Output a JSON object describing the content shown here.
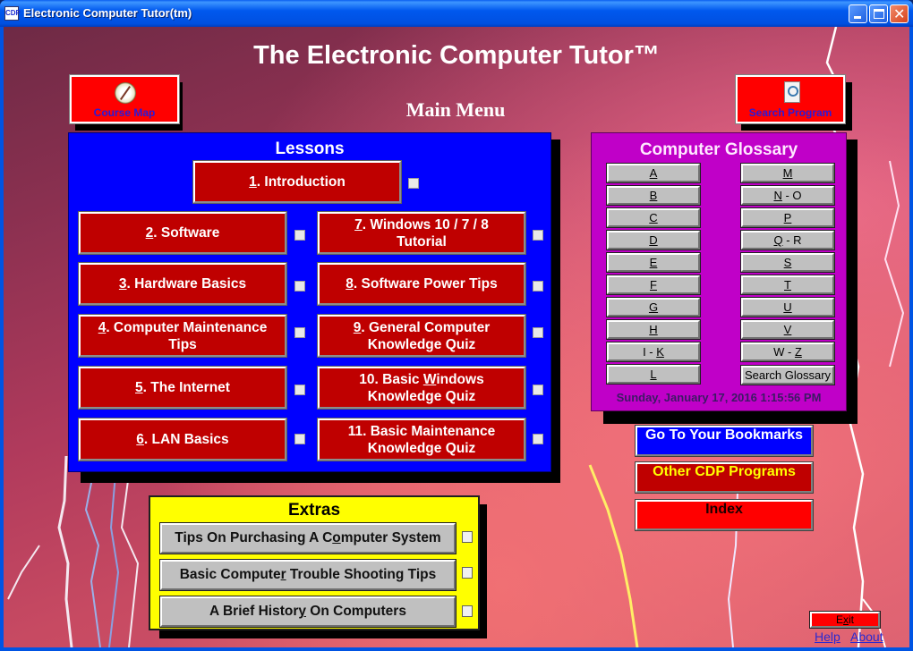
{
  "window": {
    "title": "Electronic Computer Tutor(tm)",
    "app_icon_text": "CDP",
    "controls": [
      "minimize",
      "maximize",
      "close"
    ]
  },
  "header": {
    "title": "The Electronic Computer Tutor™",
    "subtitle": "Main Menu"
  },
  "top_buttons": {
    "course_map": {
      "label": "Course Map",
      "icon": "compass-icon"
    },
    "search_program": {
      "label": "Search Program",
      "icon": "search-document-icon"
    }
  },
  "lessons": {
    "title": "Lessons",
    "items": [
      {
        "num": "1",
        "text": ". Introduction",
        "line2": ""
      },
      {
        "num": "2",
        "text": ". Software",
        "line2": ""
      },
      {
        "num": "3",
        "text": ". Hardware Basics",
        "line2": ""
      },
      {
        "num": "4",
        "text": ". Computer Maintenance",
        "line2": "Tips"
      },
      {
        "num": "5",
        "text": ". The Internet",
        "line2": ""
      },
      {
        "num": "6",
        "text": ". LAN Basics",
        "line2": ""
      },
      {
        "num": "7",
        "text": ". Windows 10 /  7 / 8",
        "line2": "Tutorial"
      },
      {
        "num": "8",
        "text": ". Software Power Tips",
        "line2": ""
      },
      {
        "num": "9",
        "text": ". General Computer",
        "line2": "Knowledge Quiz"
      },
      {
        "pre": "10. Basic ",
        "ul": "W",
        "post": "indows",
        "line2": "Knowledge Quiz"
      },
      {
        "pre": "11. Basic  Maintenance",
        "ul": "",
        "post": "",
        "line2": "Knowledge Quiz"
      }
    ]
  },
  "glossary": {
    "title": "Computer Glossary",
    "left": [
      {
        "ul": "A",
        "rest": ""
      },
      {
        "ul": "B",
        "rest": ""
      },
      {
        "ul": "C",
        "rest": ""
      },
      {
        "ul": "D",
        "rest": ""
      },
      {
        "ul": "E",
        "rest": ""
      },
      {
        "ul": "F",
        "rest": ""
      },
      {
        "ul": "G",
        "rest": ""
      },
      {
        "ul": "H",
        "rest": ""
      },
      {
        "pre": "I - ",
        "ul": "K",
        "rest": ""
      },
      {
        "ul": "L",
        "rest": ""
      }
    ],
    "right": [
      {
        "ul": "M",
        "rest": ""
      },
      {
        "ul": "N",
        "rest": " - O"
      },
      {
        "ul": "P",
        "rest": ""
      },
      {
        "ul": "Q",
        "rest": " - R"
      },
      {
        "ul": "S",
        "rest": ""
      },
      {
        "ul": "T",
        "rest": ""
      },
      {
        "ul": "U",
        "rest": ""
      },
      {
        "ul": "V",
        "rest": ""
      },
      {
        "pre": "W - ",
        "ul": "Z",
        "rest": ""
      }
    ],
    "search_label": "Search Glossary",
    "datetime": "Sunday, January 17, 2016 1:15:56 PM"
  },
  "side_buttons": {
    "bookmarks": "Go To Your Bookmarks",
    "other_programs": "Other CDP Programs",
    "index": "Index"
  },
  "extras": {
    "title": "Extras",
    "items": [
      {
        "pre": "Tips On Purchasing A C",
        "ul": "o",
        "post": "mputer System"
      },
      {
        "pre": "Basic Compute",
        "ul": "r",
        "post": " Trouble Shooting Tips"
      },
      {
        "pre": "A Brief Histor",
        "ul": "y",
        "post": " On Computers"
      }
    ]
  },
  "footer": {
    "exit_pre": "E",
    "exit_ul": "x",
    "exit_post": "it",
    "help": "Help",
    "about": "About"
  },
  "colors": {
    "lessons_panel": "#0000ff",
    "lesson_button": "#bf0000",
    "glossary_panel": "#c000c8",
    "extras_panel": "#ffff00",
    "bookmarks_button": "#0000ff",
    "other_programs_button": "#bf0000",
    "other_programs_text": "#ffff00",
    "index_button": "#ff0000",
    "top_button": "#ff0000",
    "top_button_text": "#2a1ad8"
  }
}
